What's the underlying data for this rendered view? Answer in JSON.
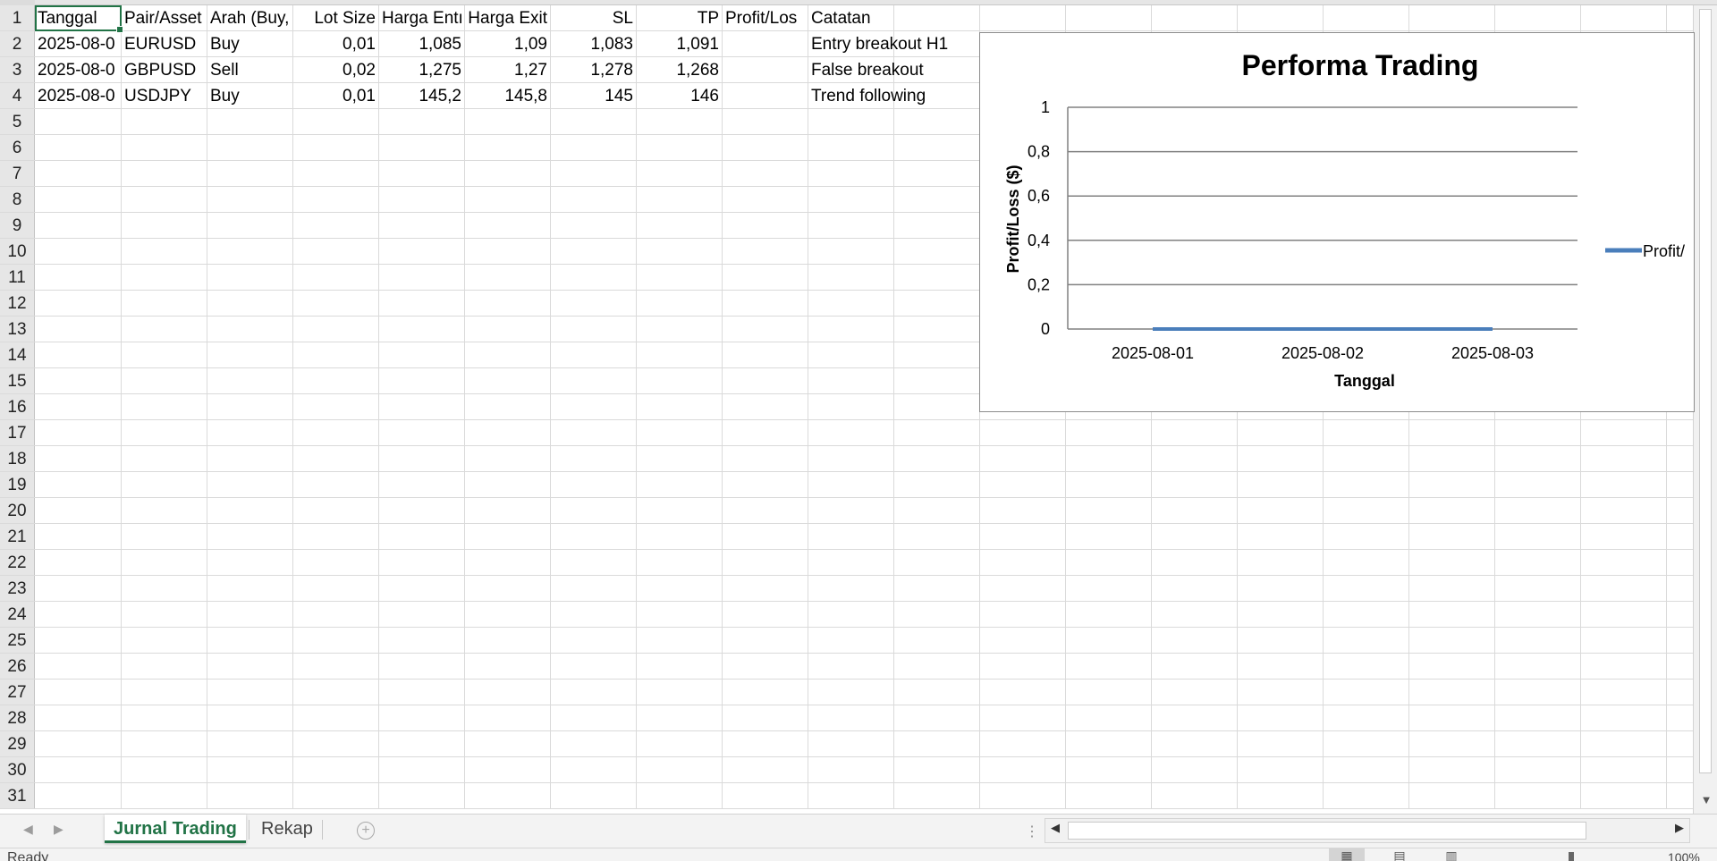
{
  "sheet": {
    "rows": [
      {
        "num": "1",
        "cells": [
          "Tanggal",
          "Pair/Asset",
          "Arah (Buy,",
          "Lot Size",
          "Harga Entı",
          "Harga Exit",
          "SL",
          "TP",
          "Profit/Los",
          "Catatan"
        ]
      },
      {
        "num": "2",
        "cells": [
          "2025-08-0",
          "EURUSD",
          "Buy",
          "0,01",
          "1,085",
          "1,09",
          "1,083",
          "1,091",
          "",
          "Entry breakout H1"
        ]
      },
      {
        "num": "3",
        "cells": [
          "2025-08-0",
          "GBPUSD",
          "Sell",
          "0,02",
          "1,275",
          "1,27",
          "1,278",
          "1,268",
          "",
          "False breakout"
        ]
      },
      {
        "num": "4",
        "cells": [
          "2025-08-0",
          "USDJPY",
          "Buy",
          "0,01",
          "145,2",
          "145,8",
          "145",
          "146",
          "",
          "Trend following"
        ]
      },
      {
        "num": "5",
        "cells": []
      },
      {
        "num": "6",
        "cells": []
      },
      {
        "num": "7",
        "cells": []
      },
      {
        "num": "8",
        "cells": []
      },
      {
        "num": "9",
        "cells": []
      },
      {
        "num": "10",
        "cells": []
      },
      {
        "num": "11",
        "cells": []
      },
      {
        "num": "12",
        "cells": []
      },
      {
        "num": "13",
        "cells": []
      },
      {
        "num": "14",
        "cells": []
      },
      {
        "num": "15",
        "cells": []
      },
      {
        "num": "16",
        "cells": []
      },
      {
        "num": "17",
        "cells": []
      },
      {
        "num": "18",
        "cells": []
      },
      {
        "num": "19",
        "cells": []
      },
      {
        "num": "20",
        "cells": []
      },
      {
        "num": "21",
        "cells": []
      },
      {
        "num": "22",
        "cells": []
      },
      {
        "num": "23",
        "cells": []
      },
      {
        "num": "24",
        "cells": []
      },
      {
        "num": "25",
        "cells": []
      },
      {
        "num": "26",
        "cells": []
      },
      {
        "num": "27",
        "cells": []
      },
      {
        "num": "28",
        "cells": []
      },
      {
        "num": "29",
        "cells": []
      },
      {
        "num": "30",
        "cells": []
      },
      {
        "num": "31",
        "cells": []
      }
    ]
  },
  "chart_data": {
    "type": "line",
    "title": "Performa Trading",
    "xlabel": "Tanggal",
    "ylabel": "Profit/Loss ($)",
    "categories": [
      "2025-08-01",
      "2025-08-02",
      "2025-08-03"
    ],
    "ylim": [
      0,
      1
    ],
    "yticks": [
      "0",
      "0,2",
      "0,4",
      "0,6",
      "0,8",
      "1"
    ],
    "grid": true,
    "legend_position": "right",
    "series": [
      {
        "name": "Profit/",
        "values": [
          0,
          0,
          0
        ],
        "color": "#4a7ebb"
      }
    ]
  },
  "tabs": {
    "items": [
      {
        "label": "Jurnal Trading",
        "active": true
      },
      {
        "label": "Rekap",
        "active": false
      }
    ]
  },
  "status": {
    "ready": "Ready",
    "zoom": "100%"
  },
  "colors": {
    "accent": "#217346",
    "series": "#4a7ebb"
  },
  "icons": {
    "tab_prev": "chevron-left-icon",
    "tab_next": "chevron-right-icon",
    "add_sheet": "plus-circle-icon",
    "split": "vertical-ellipsis-icon"
  }
}
